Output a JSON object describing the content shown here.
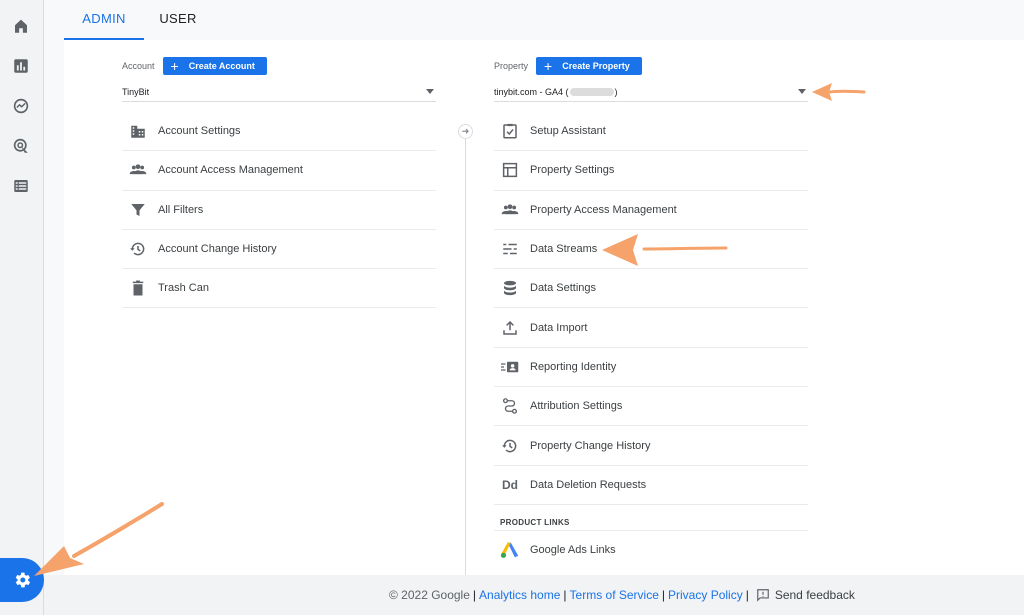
{
  "colors": {
    "accent": "#1a73e8",
    "arrow": "#f5a26b",
    "text": "#3c4043"
  },
  "rail": {
    "icons": [
      "home-icon",
      "reports-icon",
      "explore-icon",
      "advertising-icon",
      "configure-icon",
      "admin-gear-icon"
    ]
  },
  "tabs": {
    "admin": "ADMIN",
    "user": "USER"
  },
  "account": {
    "label": "Account",
    "create_button": "Create Account",
    "selected": "TinyBit",
    "items": [
      {
        "label": "Account Settings",
        "icon": "building-icon"
      },
      {
        "label": "Account Access Management",
        "icon": "people-icon"
      },
      {
        "label": "All Filters",
        "icon": "filter-icon"
      },
      {
        "label": "Account Change History",
        "icon": "history-icon"
      },
      {
        "label": "Trash Can",
        "icon": "trash-icon"
      }
    ]
  },
  "property": {
    "label": "Property",
    "create_button": "Create Property",
    "selected_prefix": "tinybit.com - GA4 (",
    "selected_suffix": ")",
    "items": [
      {
        "label": "Setup Assistant",
        "icon": "checklist-icon"
      },
      {
        "label": "Property Settings",
        "icon": "layout-icon"
      },
      {
        "label": "Property Access Management",
        "icon": "people-icon"
      },
      {
        "label": "Data Streams",
        "icon": "streams-icon"
      },
      {
        "label": "Data Settings",
        "icon": "database-icon"
      },
      {
        "label": "Data Import",
        "icon": "upload-icon"
      },
      {
        "label": "Reporting Identity",
        "icon": "identity-icon"
      },
      {
        "label": "Attribution Settings",
        "icon": "attribution-icon"
      },
      {
        "label": "Property Change History",
        "icon": "history-icon"
      },
      {
        "label": "Data Deletion Requests",
        "icon": "dd-icon",
        "icon_text": "Dd"
      }
    ],
    "product_links_header": "PRODUCT LINKS",
    "google_ads_links": "Google Ads Links"
  },
  "footer": {
    "copyright": "© 2022 Google",
    "analytics_home": "Analytics home",
    "terms": "Terms of Service",
    "privacy": "Privacy Policy",
    "separator": "|",
    "send_feedback": "Send feedback"
  }
}
